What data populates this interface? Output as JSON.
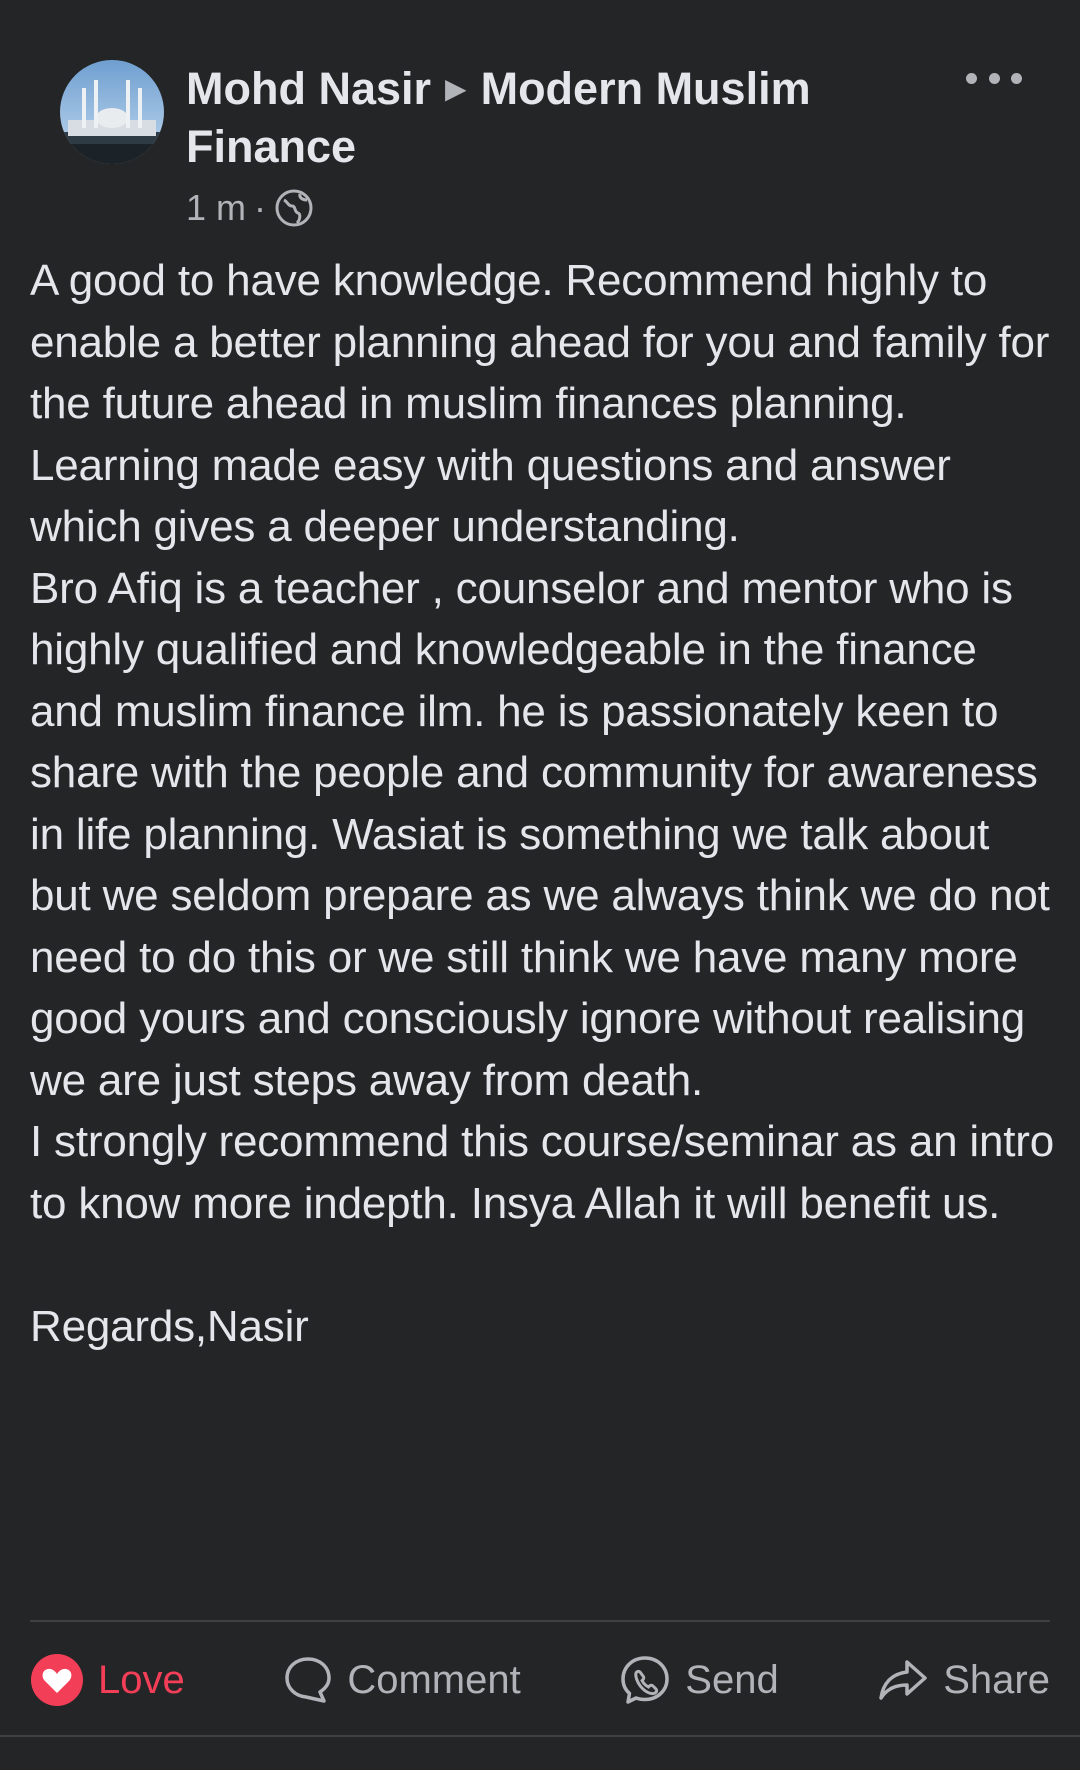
{
  "post": {
    "author": "Mohd Nasir",
    "group": "Modern Muslim Finance",
    "time": "1 m",
    "separator": "·",
    "privacy_icon": "globe-icon",
    "more_icon": "more-horizontal-icon",
    "body": "A good to have knowledge. Recommend highly to enable a better planning ahead for you and family for the future ahead in muslim finances planning.\nLearning made easy with questions and answer which gives a deeper understanding.\nBro Afiq is a teacher , counselor and mentor who is highly qualified and knowledgeable in the finance and muslim finance  ilm. he is passionately keen to share with the people and community for awareness in life planning. Wasiat is something we talk about but we seldom prepare as we always think we do not need to do this or we still think we have many more good yours and consciously ignore without realising we are just steps away from death.\nI strongly recommend this course/seminar as an intro to know more indepth. Insya Allah it will benefit us.\n\nRegards,Nasir"
  },
  "actions": {
    "love": {
      "label": "Love",
      "icon": "love-icon",
      "color": "#f33e58"
    },
    "comment": {
      "label": "Comment",
      "icon": "comment-icon"
    },
    "send": {
      "label": "Send",
      "icon": "messenger-icon"
    },
    "share": {
      "label": "Share",
      "icon": "share-icon"
    }
  },
  "colors": {
    "background": "#242526",
    "text": "#e4e6eb",
    "secondary": "#b0b3b8",
    "love": "#f33e58"
  }
}
